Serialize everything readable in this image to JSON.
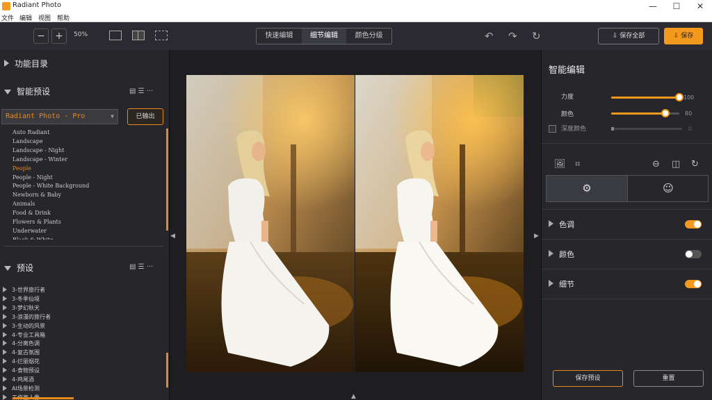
{
  "window": {
    "title": "Radiant Photo",
    "minimize": "—",
    "maximize": "☐",
    "close": "✕"
  },
  "menu": [
    "文件",
    "编辑",
    "视图",
    "帮助"
  ],
  "toolbar": {
    "zoom_out": "−",
    "zoom_in": "+",
    "zoom_level": "50%",
    "modes": [
      "快速编辑",
      "细节编辑",
      "颜色分级"
    ],
    "active_mode": 1,
    "undo": "↶",
    "redo": "↷",
    "reset": "↻",
    "save_all": "⇩ 保存全部",
    "save": "⇩ 保存"
  },
  "left": {
    "catalog_title": "功能目录",
    "smart_preset_title": "智能预设",
    "preset_selected": "Radiant Photo - Pro",
    "exported_label": "已输出",
    "list_icons": "▤ ☰ ···",
    "smart_presets": [
      "Auto Radiant",
      "Landscape",
      "Landscape - Night",
      "Landscape - Winter",
      "People",
      "People - Night",
      "People - White Background",
      "Newborn & Baby",
      "Animals",
      "Food & Drink",
      "Flowers & Plants",
      "Underwater",
      "Black & White"
    ],
    "selected_index": 4,
    "presets_title": "预设",
    "presets": [
      "3-世界旅行者",
      "3-冬季仙境",
      "3-梦幻秋天",
      "3-浪漫的旅行者",
      "3-生动的风景",
      "4-专业工具箱",
      "4-分离色调",
      "4-复古氛围",
      "4-烂丽烟花",
      "4-食物预设",
      "4-鸡尾酒",
      "AI场景检测",
      "工作室人像"
    ]
  },
  "right": {
    "title": "智能编辑",
    "sliders": [
      {
        "label": "力度",
        "value": 100,
        "max": 100
      },
      {
        "label": "颜色",
        "value": 80,
        "max": 100
      }
    ],
    "depth": {
      "label": "深度颜色",
      "value": 0
    },
    "icons": {
      "image": "🖼",
      "crop": "⌗",
      "flip_v": "⊖",
      "flip_h": "◫",
      "rotate": "↻"
    },
    "tabs": [
      "⚙",
      "☺"
    ],
    "sections": [
      {
        "label": "色调",
        "on": true
      },
      {
        "label": "颜色",
        "on": false
      },
      {
        "label": "细节",
        "on": true
      }
    ],
    "save_preset": "保存预设",
    "reset": "重置"
  },
  "colors": {
    "accent": "#f39a1e",
    "panel": "#26262b",
    "canvas": "#1d1d22"
  }
}
